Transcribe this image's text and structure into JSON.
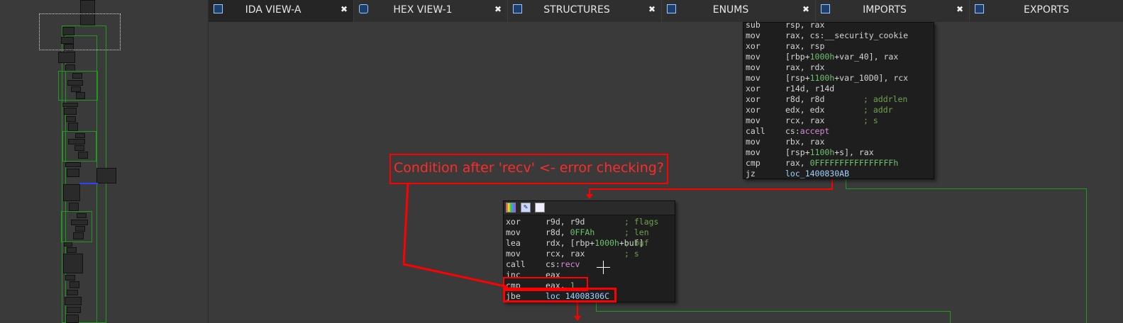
{
  "tabs": [
    {
      "label": "IDA VIEW-A",
      "close": "✖",
      "active": true,
      "icon": "ida-view-icon"
    },
    {
      "label": "HEX VIEW-1",
      "close": "✖",
      "active": false,
      "icon": "hex-view-icon"
    },
    {
      "label": "STRUCTURES",
      "close": "✖",
      "active": false,
      "icon": "structures-icon"
    },
    {
      "label": "ENUMS",
      "close": "✖",
      "active": false,
      "icon": "enums-icon"
    },
    {
      "label": "IMPORTS",
      "close": "✖",
      "active": false,
      "icon": "imports-icon"
    },
    {
      "label": "EXPORTS",
      "close": "",
      "active": false,
      "icon": "exports-icon"
    }
  ],
  "top_block": {
    "lines": [
      {
        "mn": "sub",
        "op": "rsp, rax"
      },
      {
        "mn": "mov",
        "op": "rax, cs:__security_cookie"
      },
      {
        "mn": "xor",
        "op": "rax, rsp"
      },
      {
        "mn": "mov",
        "op": "[rbp+1000h+var_40], rax"
      },
      {
        "mn": "mov",
        "op": "rax, rdx"
      },
      {
        "mn": "mov",
        "op": "[rsp+1100h+var_10D0], rcx"
      },
      {
        "mn": "xor",
        "op": "r14d, r14d"
      },
      {
        "mn": "xor",
        "op": "r8d, r8d",
        "cm": "; addrlen"
      },
      {
        "mn": "xor",
        "op": "edx, edx",
        "cm": "; addr"
      },
      {
        "mn": "mov",
        "op": "rcx, rax",
        "cm": "; s"
      },
      {
        "mn": "call",
        "op": "cs:accept"
      },
      {
        "mn": "mov",
        "op": "rbx, rax"
      },
      {
        "mn": "mov",
        "op": "[rsp+1100h+s], rax"
      },
      {
        "mn": "cmp",
        "op": "rax, 0FFFFFFFFFFFFFFFFh"
      },
      {
        "mn": "jz",
        "op": "loc_1400830AB"
      }
    ]
  },
  "recv_block": {
    "lines": [
      {
        "mn": "xor",
        "op": "r9d, r9d",
        "cm": "; flags"
      },
      {
        "mn": "mov",
        "op": "r8d, 0FFAh",
        "cm": "; len"
      },
      {
        "mn": "lea",
        "op": "rdx, [rbp+1000h+buf]",
        "cm": "; buf"
      },
      {
        "mn": "mov",
        "op": "rcx, rax",
        "cm": "; s"
      },
      {
        "mn": "call",
        "op": "cs:recv"
      },
      {
        "mn": "inc",
        "op": "eax"
      },
      {
        "mn": "cmp",
        "op": "eax, 1"
      },
      {
        "mn": "jbe",
        "op": "loc_14008306C"
      }
    ]
  },
  "annotation": {
    "text": "Condition after 'recv' <- error checking?",
    "color": "#ff0000"
  },
  "colors": {
    "edge_true": "#1f9a1f",
    "edge_false": "#ff0000",
    "comment": "#6fa24f",
    "number": "#6fbf6f",
    "symbol": "#d98ad9"
  }
}
